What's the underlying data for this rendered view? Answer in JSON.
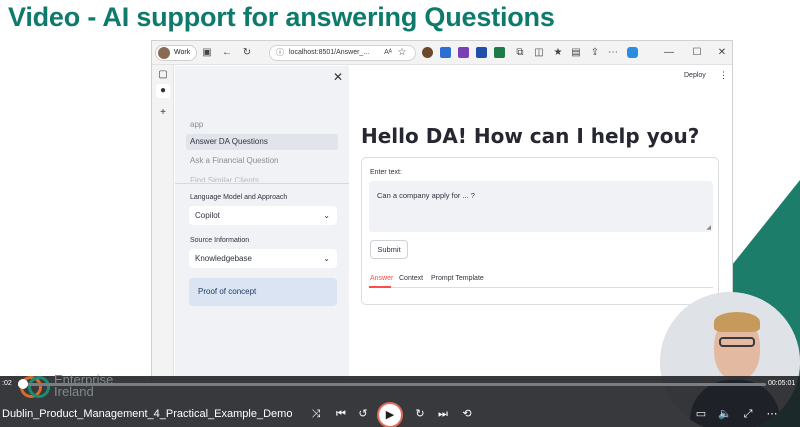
{
  "slide": {
    "title": "Video - AI support for answering Questions"
  },
  "browser": {
    "profile": "Work",
    "url": "localhost:8501/Answer_...",
    "reader_label": "Aᴬ"
  },
  "sidebar": {
    "app_label": "app",
    "nav": [
      {
        "label": "Answer DA Questions",
        "active": true
      },
      {
        "label": "Ask a Financial Question",
        "active": false
      },
      {
        "label": "Find Similar Clients",
        "active": false
      }
    ],
    "model_label": "Language Model and Approach",
    "model_value": "Copilot",
    "source_label": "Source Information",
    "source_value": "Knowledgebase",
    "info_text": "Proof of concept"
  },
  "main": {
    "deploy_label": "Deploy",
    "heading": "Hello DA! How can I help you?",
    "input_label": "Enter text:",
    "input_value": "Can a company apply for ... ?",
    "submit_label": "Submit",
    "tabs": [
      {
        "label": "Answer",
        "active": true
      },
      {
        "label": "Context",
        "active": false
      },
      {
        "label": "Prompt Template",
        "active": false
      }
    ]
  },
  "player": {
    "brand_line1": "Enterprise",
    "brand_line2": "Ireland",
    "time_current": ":02",
    "time_total": "00:05:01",
    "video_title": "Dublin_Product_Management_4_Practical_Example_Demo",
    "progress": 0.007,
    "accent_color": "#e36b5a"
  },
  "colors": {
    "title_green": "#0d7a6b",
    "streamlit_red": "#ff4b4b",
    "sidebar_bg": "#f0f2f6"
  }
}
